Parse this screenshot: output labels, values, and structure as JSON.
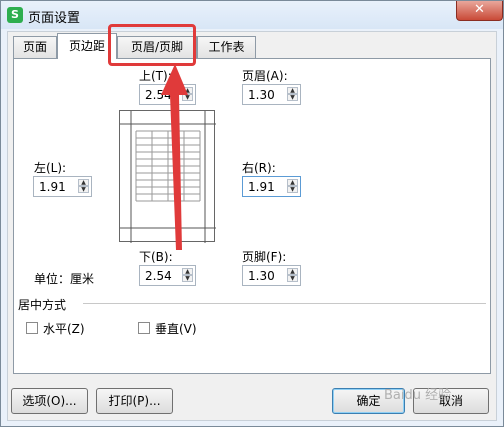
{
  "window": {
    "title": "页面设置",
    "app_icon_letter": "S",
    "close_glyph": "✕"
  },
  "tabs": [
    {
      "label": "页面"
    },
    {
      "label": "页边距"
    },
    {
      "label": "页眉/页脚"
    },
    {
      "label": "工作表"
    }
  ],
  "margins": {
    "top": {
      "label": "上(T):",
      "value": "2.54"
    },
    "header": {
      "label": "页眉(A):",
      "value": "1.30"
    },
    "left": {
      "label": "左(L):",
      "value": "1.91"
    },
    "right": {
      "label": "右(R):",
      "value": "1.91"
    },
    "bottom": {
      "label": "下(B):",
      "value": "2.54"
    },
    "footer": {
      "label": "页脚(F):",
      "value": "1.30"
    }
  },
  "unit_label": "单位：厘米",
  "center": {
    "group_label": "居中方式",
    "horizontal_label": "水平(Z)",
    "vertical_label": "垂直(V)"
  },
  "buttons": {
    "options": "选项(O)...",
    "print": "打印(P)...",
    "ok": "确定",
    "cancel": "取消"
  },
  "watermark": "Baidu 经验",
  "colors": {
    "highlight": "#e03a3a",
    "arrow": "#e03a3a"
  }
}
